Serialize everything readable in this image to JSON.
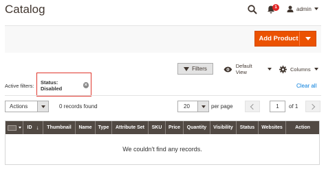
{
  "header": {
    "title": "Catalog",
    "notifications_count": "1",
    "user_name": "admin"
  },
  "actions_band": {
    "add_product_label": "Add Product"
  },
  "toolbar": {
    "filters_label": "Filters",
    "view_label": "Default View",
    "columns_label": "Columns"
  },
  "active_filters": {
    "label": "Active filters:",
    "chip_label": "Status: Disabled",
    "clear_all_label": "Clear all"
  },
  "grid_controls": {
    "actions_label": "Actions",
    "records_found": "0 records found",
    "per_page_value": "20",
    "per_page_label": "per page",
    "current_page": "1",
    "page_of": "of 1"
  },
  "table": {
    "columns": [
      "ID",
      "Thumbnail",
      "Name",
      "Type",
      "Attribute Set",
      "SKU",
      "Price",
      "Quantity",
      "Visibility",
      "Status",
      "Websites",
      "Action"
    ],
    "sort_indicator": "↓",
    "empty_message": "We couldn't find any records."
  },
  "colors": {
    "accent": "#eb5202",
    "header_bg": "#514943",
    "link": "#007bdb",
    "highlight": "#e0352b"
  }
}
